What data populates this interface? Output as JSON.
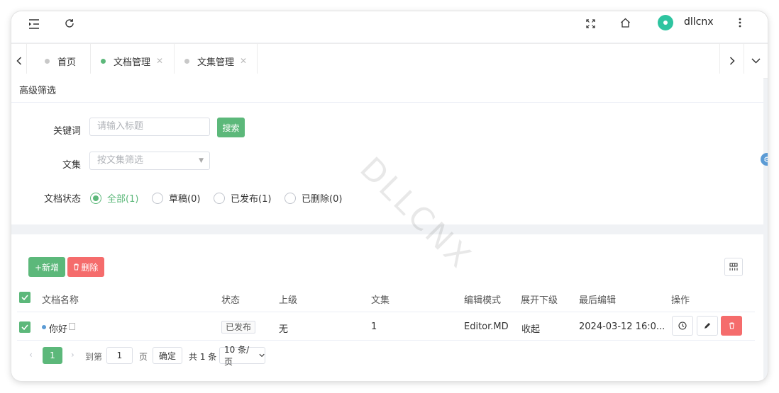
{
  "header": {
    "username": "dllcnx"
  },
  "tabs": [
    {
      "label": "首页",
      "active": false,
      "closable": false
    },
    {
      "label": "文档管理",
      "active": true,
      "closable": true
    },
    {
      "label": "文集管理",
      "active": false,
      "closable": true
    }
  ],
  "filter": {
    "title": "高级筛选",
    "keyword_label": "关键词",
    "keyword_placeholder": "请输入标题",
    "search_label": "搜索",
    "collection_label": "文集",
    "collection_placeholder": "按文集筛选",
    "status_label": "文档状态",
    "status_options": [
      {
        "label": "全部(1)",
        "checked": true
      },
      {
        "label": "草稿(0)",
        "checked": false
      },
      {
        "label": "已发布(1)",
        "checked": false
      },
      {
        "label": "已删除(0)",
        "checked": false
      }
    ]
  },
  "watermark": "DLLCNX",
  "toolbar": {
    "add_label": "+新增",
    "delete_label": "删除"
  },
  "table": {
    "columns": [
      "文档名称",
      "状态",
      "上级",
      "文集",
      "编辑模式",
      "展开下级",
      "最后编辑",
      "操作"
    ],
    "rows": [
      {
        "name": "你好",
        "status": "已发布",
        "parent": "无",
        "collection": "1",
        "edit_mode": "Editor.MD",
        "expand": "收起",
        "last_edit": "2024-03-12 16:0..."
      }
    ]
  },
  "pagination": {
    "current_page": "1",
    "goto_label": "到第",
    "goto_value": "1",
    "page_unit": "页",
    "confirm_label": "确定",
    "total_label": "共 1 条",
    "page_size": "10 条/页"
  },
  "colors": {
    "accent": "#5cb87a",
    "danger": "#f56c6c",
    "avatar": "#2ec4a0"
  }
}
